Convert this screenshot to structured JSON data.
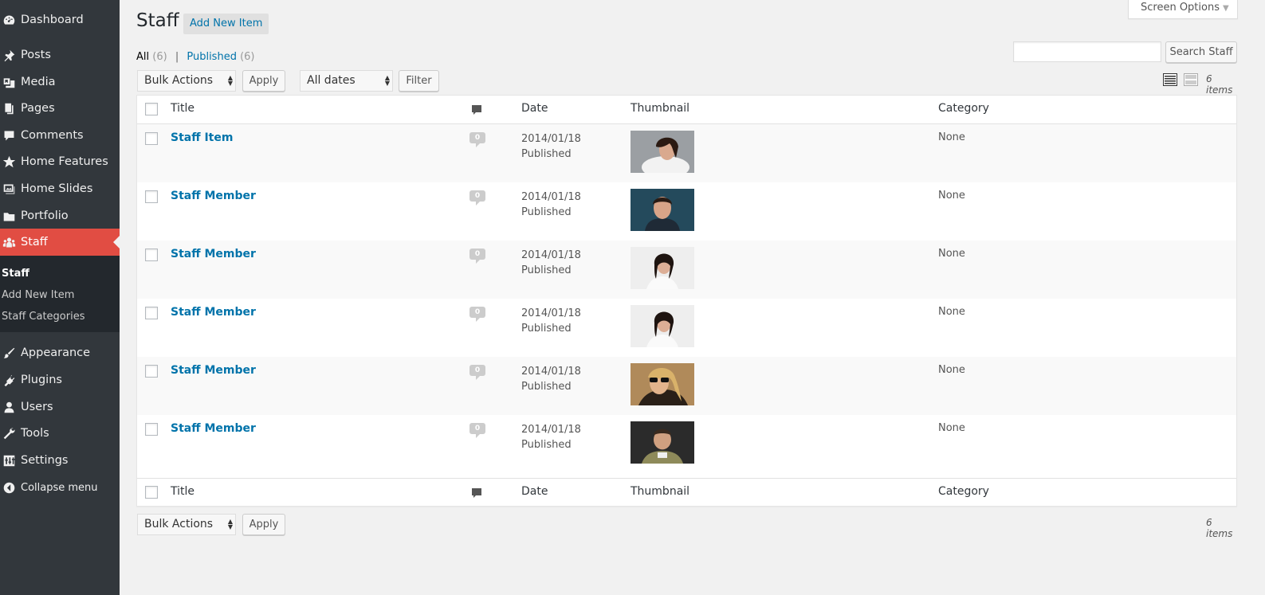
{
  "sidebar": {
    "items_top": [
      {
        "label": "Dashboard",
        "icon": "dashboard-icon"
      },
      {
        "label": "Posts",
        "icon": "pin-icon"
      },
      {
        "label": "Media",
        "icon": "media-icon"
      },
      {
        "label": "Pages",
        "icon": "pages-icon"
      },
      {
        "label": "Comments",
        "icon": "comment-icon"
      },
      {
        "label": "Home Features",
        "icon": "star-icon"
      },
      {
        "label": "Home Slides",
        "icon": "slides-icon"
      },
      {
        "label": "Portfolio",
        "icon": "folder-icon"
      },
      {
        "label": "Staff",
        "icon": "groups-icon"
      }
    ],
    "submenu": [
      "Staff",
      "Add New Item",
      "Staff Categories"
    ],
    "items_bottom": [
      {
        "label": "Appearance",
        "icon": "brush-icon"
      },
      {
        "label": "Plugins",
        "icon": "plugin-icon"
      },
      {
        "label": "Users",
        "icon": "user-icon"
      },
      {
        "label": "Tools",
        "icon": "wrench-icon"
      },
      {
        "label": "Settings",
        "icon": "settings-icon"
      },
      {
        "label": "Collapse menu",
        "icon": "collapse-icon"
      }
    ],
    "active_color": "#e14d43"
  },
  "header": {
    "title": "Staff",
    "add_new": "Add New Item",
    "screen_options": "Screen Options"
  },
  "filters": {
    "all_label": "All",
    "all_count": "(6)",
    "published_label": "Published",
    "published_count": "(6)",
    "separator": "|"
  },
  "search": {
    "placeholder": "",
    "button": "Search Staff"
  },
  "tablenav": {
    "bulk_actions": "Bulk Actions",
    "apply": "Apply",
    "dates": "All dates",
    "filter": "Filter",
    "items_count": "6 items"
  },
  "table": {
    "columns": {
      "title": "Title",
      "comments_icon": "comment-icon",
      "date": "Date",
      "thumbnail": "Thumbnail",
      "category": "Category"
    },
    "rows": [
      {
        "title": "Staff Item",
        "comments": "0",
        "date": "2014/01/18",
        "status": "Published",
        "category": "None",
        "thumb": "woman-portrait-thumbnail"
      },
      {
        "title": "Staff Member",
        "comments": "0",
        "date": "2014/01/18",
        "status": "Published",
        "category": "None",
        "thumb": "man-portrait-thumbnail"
      },
      {
        "title": "Staff Member",
        "comments": "0",
        "date": "2014/01/18",
        "status": "Published",
        "category": "None",
        "thumb": "woman-portrait-thumbnail"
      },
      {
        "title": "Staff Member",
        "comments": "0",
        "date": "2014/01/18",
        "status": "Published",
        "category": "None",
        "thumb": "woman-portrait-thumbnail"
      },
      {
        "title": "Staff Member",
        "comments": "0",
        "date": "2014/01/18",
        "status": "Published",
        "category": "None",
        "thumb": "woman-sunglasses-thumbnail"
      },
      {
        "title": "Staff Member",
        "comments": "0",
        "date": "2014/01/18",
        "status": "Published",
        "category": "None",
        "thumb": "man-portrait-thumbnail"
      }
    ]
  }
}
